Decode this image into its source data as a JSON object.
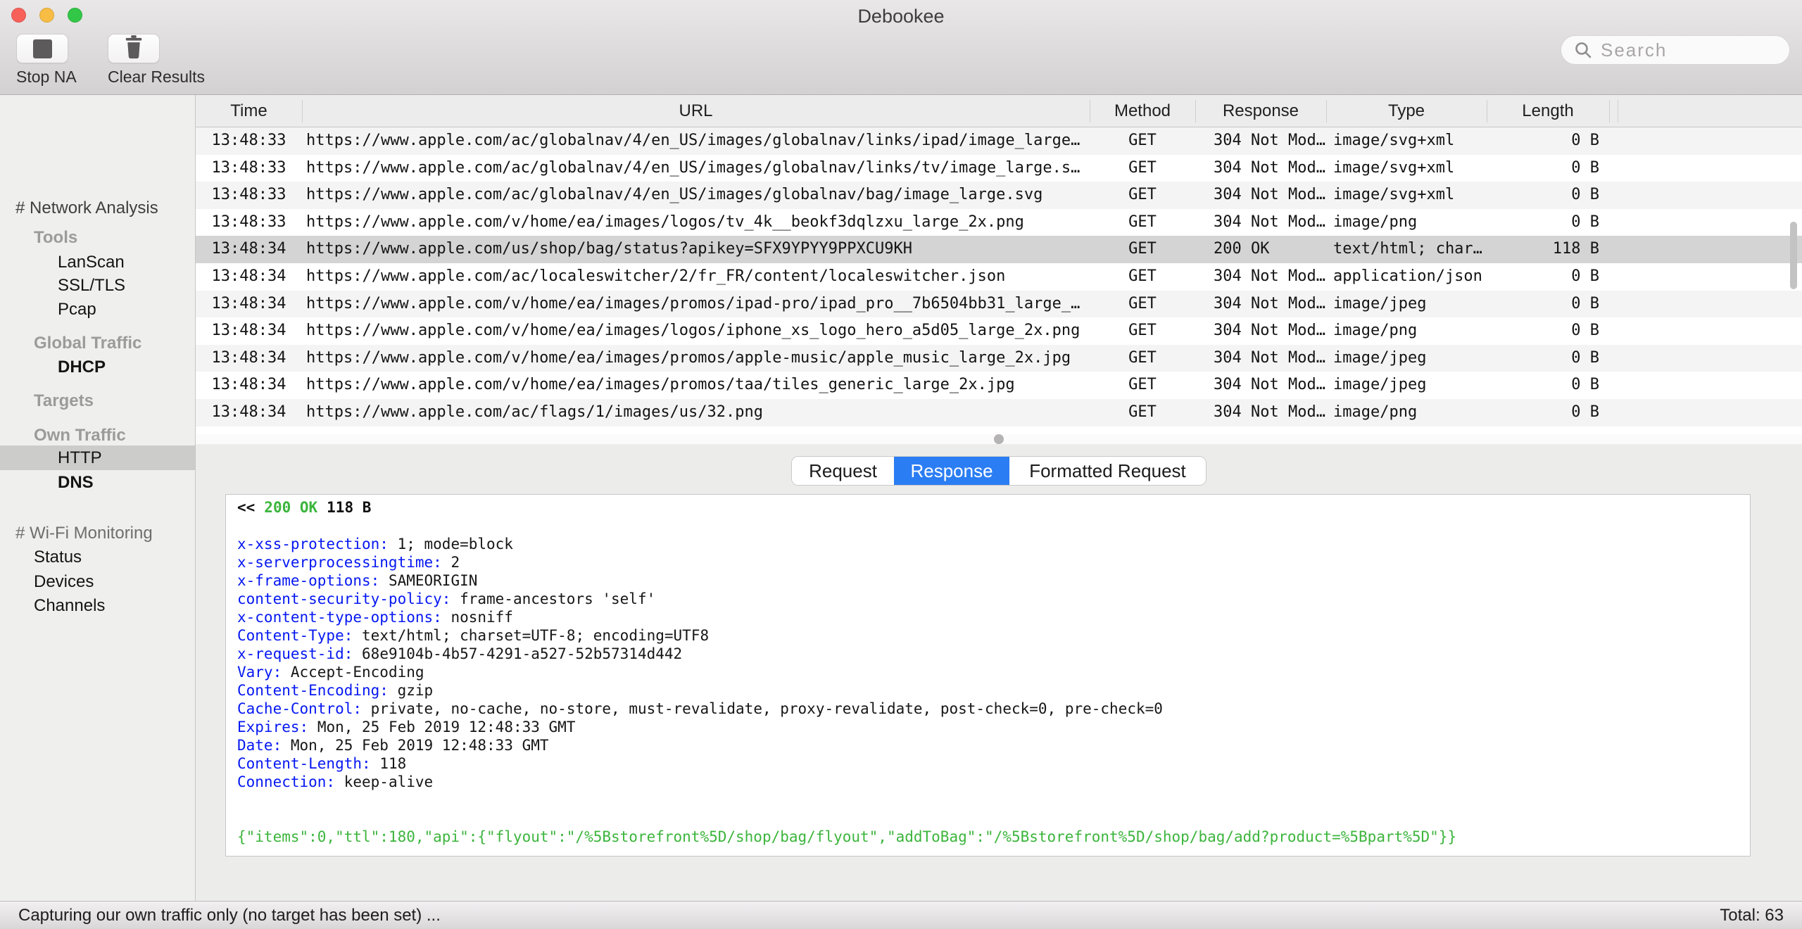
{
  "window": {
    "title": "Debookee"
  },
  "toolbar": {
    "stop_button": "Stop NA",
    "clear_button": "Clear Results",
    "search_placeholder": "Search"
  },
  "icons": {
    "stop_na": "stop-square",
    "clear_results": "trash-can",
    "search": "magnifier",
    "splitter": "drag-dot"
  },
  "colors": {
    "accent_blue": "#2b7df3",
    "status_green": "#3cb53c",
    "header_key_blue": "#0518f2",
    "selected_row": "#d4d4d4"
  },
  "sidebar": {
    "items": [
      {
        "label": "# Network Analysis",
        "type": "header"
      },
      {
        "label": "Tools",
        "type": "group"
      },
      {
        "label": "LanScan",
        "type": "item"
      },
      {
        "label": "SSL/TLS",
        "type": "item"
      },
      {
        "label": "Pcap",
        "type": "item"
      },
      {
        "label": "Global Traffic",
        "type": "group"
      },
      {
        "label": "DHCP",
        "type": "item-bold"
      },
      {
        "label": "Targets",
        "type": "group"
      },
      {
        "label": "Own Traffic",
        "type": "group"
      },
      {
        "label": "HTTP",
        "type": "item",
        "selected": true
      },
      {
        "label": "DNS",
        "type": "item-bold"
      },
      {
        "label": "# Wi-Fi Monitoring",
        "type": "header"
      },
      {
        "label": "Status",
        "type": "item2"
      },
      {
        "label": "Devices",
        "type": "item2"
      },
      {
        "label": "Channels",
        "type": "item2"
      }
    ]
  },
  "table": {
    "columns": [
      "Time",
      "URL",
      "Method",
      "Response",
      "Type",
      "Length"
    ],
    "rows": [
      {
        "time": "13:48:33",
        "url": "https://www.apple.com/ac/globalnav/4/en_US/images/globalnav/links/ipad/image_large…",
        "method": "GET",
        "response": "304 Not Mod…",
        "type": "image/svg+xml",
        "length": "0 B"
      },
      {
        "time": "13:48:33",
        "url": "https://www.apple.com/ac/globalnav/4/en_US/images/globalnav/links/tv/image_large.s…",
        "method": "GET",
        "response": "304 Not Mod…",
        "type": "image/svg+xml",
        "length": "0 B"
      },
      {
        "time": "13:48:33",
        "url": "https://www.apple.com/ac/globalnav/4/en_US/images/globalnav/bag/image_large.svg",
        "method": "GET",
        "response": "304 Not Mod…",
        "type": "image/svg+xml",
        "length": "0 B"
      },
      {
        "time": "13:48:33",
        "url": "https://www.apple.com/v/home/ea/images/logos/tv_4k__beokf3dqlzxu_large_2x.png",
        "method": "GET",
        "response": "304 Not Mod…",
        "type": "image/png",
        "length": "0 B"
      },
      {
        "time": "13:48:34",
        "url": "https://www.apple.com/us/shop/bag/status?apikey=SFX9YPYY9PPXCU9KH",
        "method": "GET",
        "response": "200 OK",
        "type": "text/html; char…",
        "length": "118 B",
        "selected": true
      },
      {
        "time": "13:48:34",
        "url": "https://www.apple.com/ac/localeswitcher/2/fr_FR/content/localeswitcher.json",
        "method": "GET",
        "response": "304 Not Mod…",
        "type": "application/json",
        "length": "0 B"
      },
      {
        "time": "13:48:34",
        "url": "https://www.apple.com/v/home/ea/images/promos/ipad-pro/ipad_pro__7b6504bb31_large_…",
        "method": "GET",
        "response": "304 Not Mod…",
        "type": "image/jpeg",
        "length": "0 B"
      },
      {
        "time": "13:48:34",
        "url": "https://www.apple.com/v/home/ea/images/logos/iphone_xs_logo_hero_a5d05_large_2x.png",
        "method": "GET",
        "response": "304 Not Mod…",
        "type": "image/png",
        "length": "0 B"
      },
      {
        "time": "13:48:34",
        "url": "https://www.apple.com/v/home/ea/images/promos/apple-music/apple_music_large_2x.jpg",
        "method": "GET",
        "response": "304 Not Mod…",
        "type": "image/jpeg",
        "length": "0 B"
      },
      {
        "time": "13:48:34",
        "url": "https://www.apple.com/v/home/ea/images/promos/taa/tiles_generic_large_2x.jpg",
        "method": "GET",
        "response": "304 Not Mod…",
        "type": "image/jpeg",
        "length": "0 B"
      },
      {
        "time": "13:48:34",
        "url": "https://www.apple.com/ac/flags/1/images/us/32.png",
        "method": "GET",
        "response": "304 Not Mod…",
        "type": "image/png",
        "length": "0 B"
      }
    ]
  },
  "tabs": {
    "items": [
      "Request",
      "Response",
      "Formatted Request"
    ],
    "selected": "Response"
  },
  "response_view": {
    "status_prefix": "<<",
    "status_code": "200 OK",
    "status_size": "118 B",
    "headers": [
      {
        "key": "x-xss-protection:",
        "value": "1; mode=block"
      },
      {
        "key": "x-serverprocessingtime:",
        "value": "2"
      },
      {
        "key": "x-frame-options:",
        "value": "SAMEORIGIN"
      },
      {
        "key": "content-security-policy:",
        "value": "frame-ancestors 'self'"
      },
      {
        "key": "x-content-type-options:",
        "value": "nosniff"
      },
      {
        "key": "Content-Type:",
        "value": "text/html; charset=UTF-8; encoding=UTF8"
      },
      {
        "key": "x-request-id:",
        "value": "68e9104b-4b57-4291-a527-52b57314d442"
      },
      {
        "key": "Vary:",
        "value": "Accept-Encoding"
      },
      {
        "key": "Content-Encoding:",
        "value": "gzip"
      },
      {
        "key": "Cache-Control:",
        "value": "private, no-cache, no-store, must-revalidate, proxy-revalidate, post-check=0, pre-check=0"
      },
      {
        "key": "Expires:",
        "value": "Mon, 25 Feb 2019 12:48:33 GMT"
      },
      {
        "key": "Date:",
        "value": "Mon, 25 Feb 2019 12:48:33 GMT"
      },
      {
        "key": "Content-Length:",
        "value": "118"
      },
      {
        "key": "Connection:",
        "value": "keep-alive"
      }
    ],
    "body": "{\"items\":0,\"ttl\":180,\"api\":{\"flyout\":\"/%5Bstorefront%5D/shop/bag/flyout\",\"addToBag\":\"/%5Bstorefront%5D/shop/bag/add?product=%5Bpart%5D\"}}"
  },
  "statusbar": {
    "left": "Capturing our own traffic only (no target has been set) ...",
    "right": "Total: 63"
  }
}
